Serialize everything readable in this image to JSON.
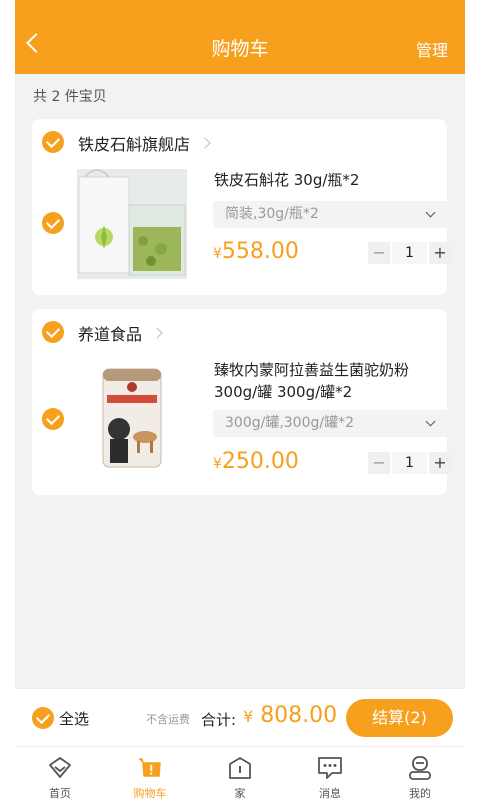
{
  "header": {
    "title": "购物车",
    "manage": "管理"
  },
  "summary": {
    "count_text": "共 2 件宝贝"
  },
  "shops": [
    {
      "name": "铁皮石斛旗舰店",
      "item": {
        "name": "铁皮石斛花 30g/瓶*2",
        "spec": "简装,30g/瓶*2",
        "price_symbol": "¥",
        "price": "558.00",
        "quantity": "1"
      }
    },
    {
      "name": "养道食品",
      "item": {
        "name_line1": "臻牧内蒙阿拉善益生菌驼奶粉",
        "name_line2": "300g/罐 300g/罐*2",
        "spec": "300g/罐,300g/罐*2",
        "price_symbol": "¥",
        "price": "250.00",
        "quantity": "1"
      }
    }
  ],
  "stepper": {
    "minus": "−",
    "plus": "+"
  },
  "footer": {
    "select_all": "全选",
    "no_shipping": "不含运费",
    "total_label": "合计:",
    "total_symbol": "¥",
    "total_amount": "808.00",
    "checkout": "结算(2)"
  },
  "tabs": [
    {
      "label": "首页",
      "icon": "home-icon"
    },
    {
      "label": "购物车",
      "icon": "cart-icon",
      "active": true
    },
    {
      "label": "家",
      "icon": "house-icon"
    },
    {
      "label": "消息",
      "icon": "message-icon"
    },
    {
      "label": "我的",
      "icon": "profile-icon"
    }
  ],
  "colors": {
    "accent": "#f7a01e",
    "background": "#f2f2f2"
  }
}
